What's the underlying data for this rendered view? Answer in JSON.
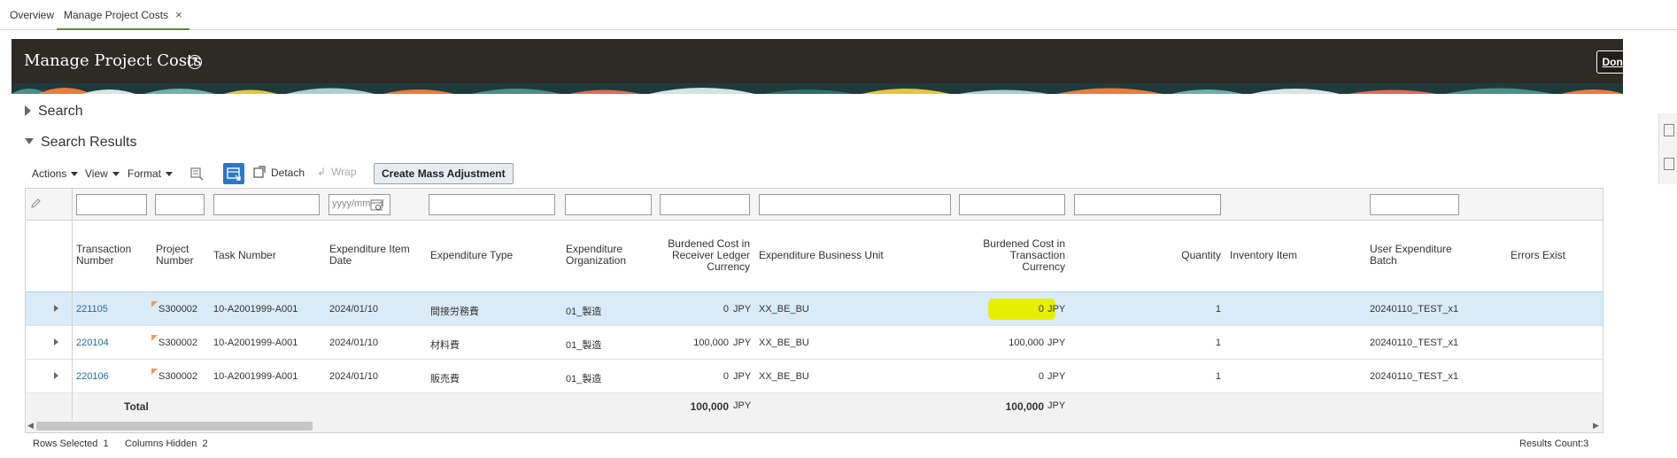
{
  "tabs": {
    "overview": "Overview",
    "active": "Manage Project Costs",
    "close": "×"
  },
  "header": {
    "title": "Manage Project Costs",
    "help": "?",
    "done": "Done"
  },
  "sections": {
    "search": "Search",
    "results": "Search Results"
  },
  "toolbar": {
    "actions": "Actions",
    "view": "View",
    "format": "Format",
    "detach": "Detach",
    "wrap": "Wrap",
    "mass_adjustment": "Create Mass Adjustment"
  },
  "filters": {
    "date_placeholder": "yyyy/mm/dd"
  },
  "columns": {
    "transaction_number": [
      "Transaction",
      "Number"
    ],
    "project_number": [
      "Project",
      "Number"
    ],
    "task_number": "Task Number",
    "expenditure_item_date": [
      "Expenditure Item",
      "Date"
    ],
    "expenditure_type": "Expenditure Type",
    "expenditure_organization": [
      "Expenditure",
      "Organization"
    ],
    "burdened_receiver": [
      "Burdened Cost in",
      "Receiver Ledger",
      "Currency"
    ],
    "business_unit": "Expenditure Business Unit",
    "burdened_transaction": [
      "Burdened Cost in",
      "Transaction",
      "Currency"
    ],
    "quantity": "Quantity",
    "inventory_item": "Inventory Item",
    "user_batch": [
      "User Expenditure",
      "Batch"
    ],
    "errors_exist": "Errors Exist"
  },
  "rows": [
    {
      "transaction": "221105",
      "project": "S300002",
      "task": "10-A2001999-A001",
      "date": "2024/01/10",
      "exp_type": "間接労務費",
      "org": "01_製造",
      "cost_recv": "0",
      "cur_recv": "JPY",
      "bu": "XX_BE_BU",
      "cost_txn": "0",
      "cur_txn": "JPY",
      "qty": "1",
      "batch": "20240110_TEST_x1"
    },
    {
      "transaction": "220104",
      "project": "S300002",
      "task": "10-A2001999-A001",
      "date": "2024/01/10",
      "exp_type": "材料費",
      "org": "01_製造",
      "cost_recv": "100,000",
      "cur_recv": "JPY",
      "bu": "XX_BE_BU",
      "cost_txn": "100,000",
      "cur_txn": "JPY",
      "qty": "1",
      "batch": "20240110_TEST_x1"
    },
    {
      "transaction": "220106",
      "project": "S300002",
      "task": "10-A2001999-A001",
      "date": "2024/01/10",
      "exp_type": "販売費",
      "org": "01_製造",
      "cost_recv": "0",
      "cur_recv": "JPY",
      "bu": "XX_BE_BU",
      "cost_txn": "0",
      "cur_txn": "JPY",
      "qty": "1",
      "batch": "20240110_TEST_x1"
    }
  ],
  "total": {
    "label": "Total",
    "recv": "100,000",
    "recv_cur": "JPY",
    "txn": "100,000",
    "txn_cur": "JPY"
  },
  "status": {
    "rows_selected_label": "Rows Selected",
    "rows_selected": "1",
    "columns_hidden_label": "Columns Hidden",
    "columns_hidden": "2",
    "results_count": "Results Count:3"
  },
  "colors": {
    "header_bg": "#2e2a26",
    "link": "#1e6aa8",
    "selected_row": "#d9ebf8",
    "highlight": "#e6ef00",
    "accent": "#2b78c8"
  }
}
